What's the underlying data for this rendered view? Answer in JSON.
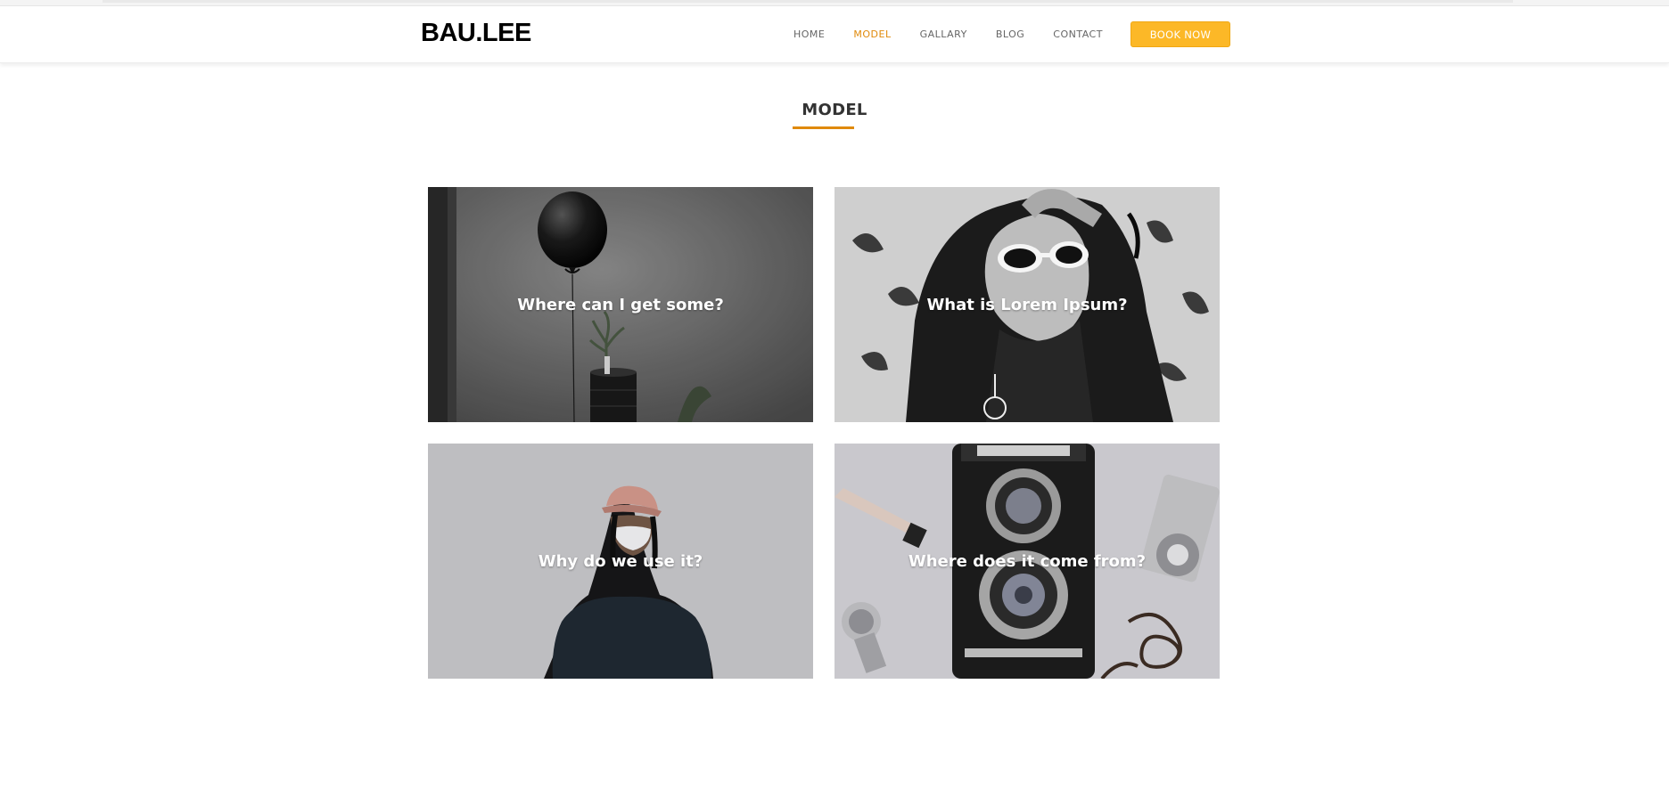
{
  "brand": {
    "logo": "BAU.LEE"
  },
  "nav": {
    "items": [
      {
        "label": "HOME",
        "active": false
      },
      {
        "label": "MODEL",
        "active": true
      },
      {
        "label": "GALLARY",
        "active": false
      },
      {
        "label": "BLOG",
        "active": false
      },
      {
        "label": "CONTACT",
        "active": false
      }
    ],
    "cta_label": "BOOK NOW"
  },
  "section": {
    "title": "MODEL"
  },
  "cards": [
    {
      "caption": "Where can I get some?",
      "image": "black balloon and potted plant"
    },
    {
      "caption": "What is Lorem Ipsum?",
      "image": "woman with white sunglasses"
    },
    {
      "caption": "Why do we use it?",
      "image": "person with pink cap and face mask"
    },
    {
      "caption": "Where does it come from?",
      "image": "vintage twin-lens camera"
    }
  ],
  "colors": {
    "accent": "#e08a0b",
    "button": "#fcb827",
    "text": "#333333"
  }
}
